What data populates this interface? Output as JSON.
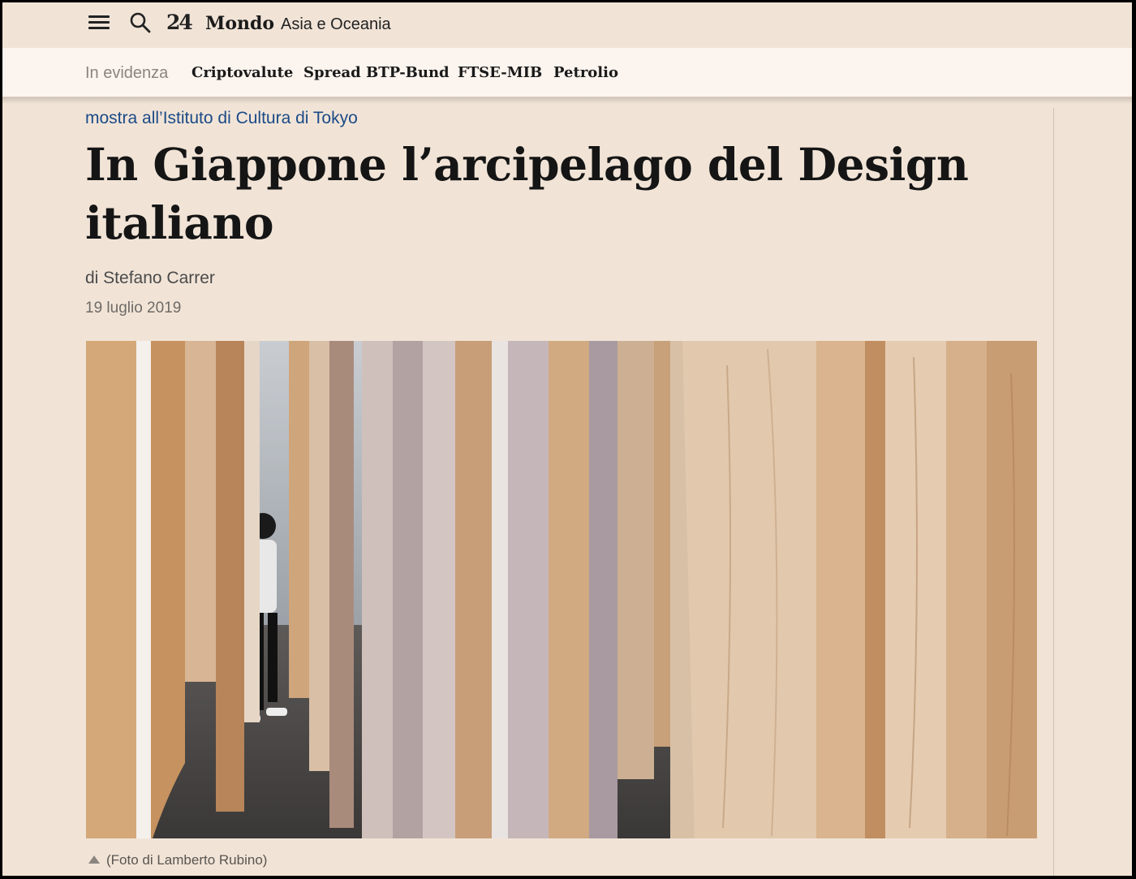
{
  "header": {
    "logo": "24",
    "section": "Mondo",
    "subsection": "Asia e Oceania"
  },
  "highlights": {
    "label": "In evidenza",
    "links": [
      "Criptovalute",
      "Spread BTP-Bund",
      "FTSE-MIB",
      "Petrolio"
    ]
  },
  "article": {
    "kicker": "mostra all’Istituto di Cultura di Tokyo",
    "title": "In Giappone l’arcipelago del Design italiano",
    "author": "di Stefano Carrer",
    "date": "19 luglio 2019",
    "caption": "(Foto di Lamberto Rubino)"
  },
  "colors": {
    "background": "#f1e4d7",
    "highlight_bar": "#fcf4ee",
    "kicker": "#1c4a86"
  }
}
